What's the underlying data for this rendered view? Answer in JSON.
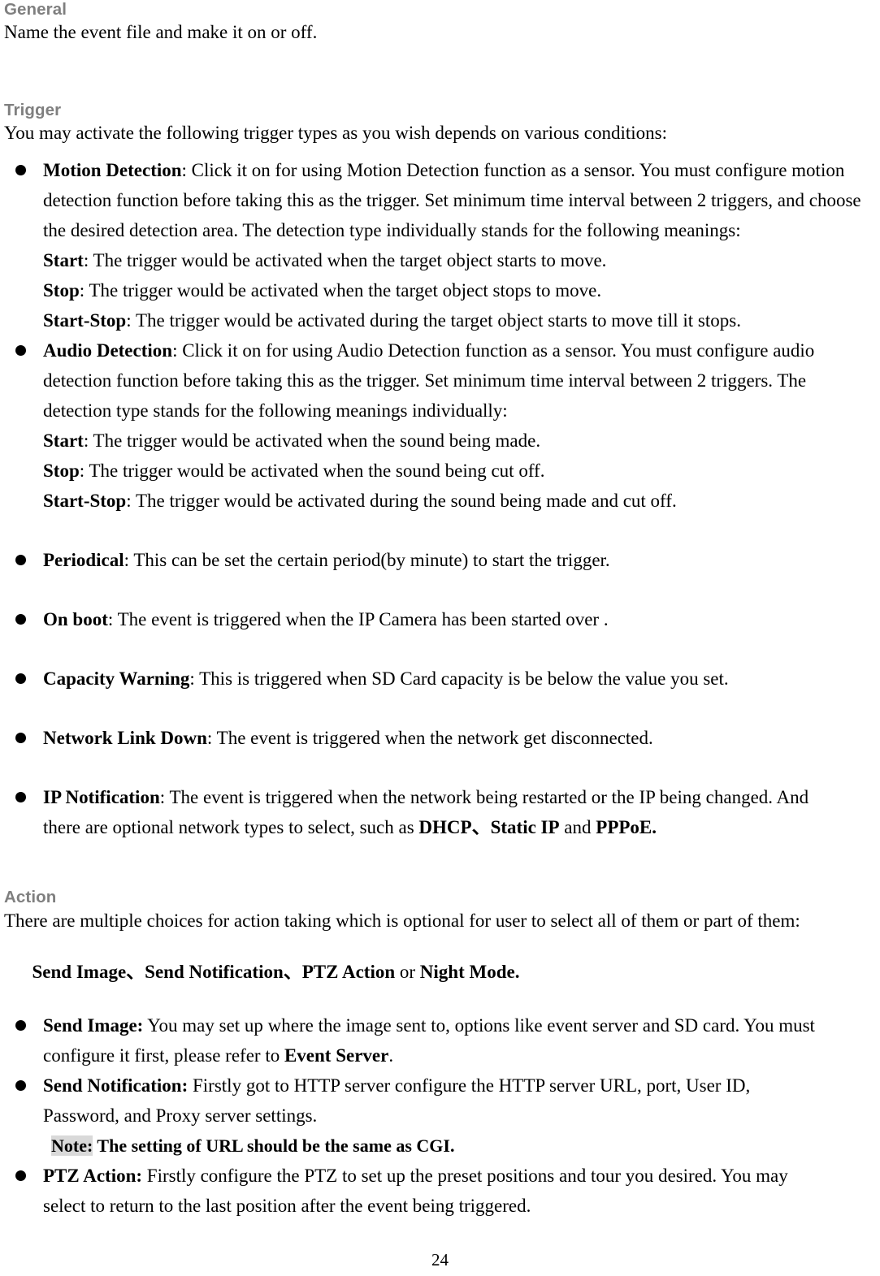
{
  "document": {
    "page_number": "24",
    "sections": [
      {
        "heading": "General",
        "intro": "Name the event file and make it on or off."
      },
      {
        "heading": "Trigger",
        "intro": "You may activate the following trigger types as you wish depends on various conditions:"
      },
      {
        "heading": "Action",
        "intro": "There are multiple choices for action taking which is optional for user to select all of them or part of them:",
        "intro2_parts": {
          "a": "Send Image",
          "sep1": "、",
          "b": "Send Notification",
          "sep2": "、",
          "c": "PTZ Action",
          "or": " or ",
          "d": "Night Mode."
        }
      }
    ]
  },
  "trigger_items": {
    "motion": {
      "term": "Motion Detection",
      "body": ": Click it on for using Motion Detection function as a sensor. You must configure motion detection function before taking this as the trigger. Set minimum time interval between 2 triggers, and choose the desired detection area. The detection type individually stands for the following meanings:",
      "start_term": "Start",
      "start_body": ": The trigger would be activated when the target object starts to move.",
      "stop_term": "Stop",
      "stop_body": ": The trigger would be activated when the target object stops to move.",
      "startstop_term": "Start-Stop",
      "startstop_body": ": The trigger would be activated during the target object starts to move till it stops."
    },
    "audio": {
      "term": "Audio Detection",
      "body": ": Click it on for using Audio Detection function as a sensor. You must configure audio detection function before taking this as the trigger. Set minimum time interval between 2 triggers. The detection type stands for the following meanings individually:",
      "start_term": "Start",
      "start_body": ": The trigger would be activated when the sound being made.",
      "stop_term": "Stop",
      "stop_body": ": The trigger would be activated when the sound being cut off.",
      "startstop_term": "Start-Stop",
      "startstop_body": ": The trigger would be activated during the sound being made and cut off."
    },
    "periodical": {
      "term": "Periodical",
      "body": ": This can be set the certain period(by minute) to start the trigger."
    },
    "on_boot": {
      "term": "On boot",
      "body": ": The event is triggered when the IP Camera has been started over ."
    },
    "capacity_warning": {
      "term": "Capacity Warning",
      "body": ": This is triggered when SD Card capacity is be below the value you set."
    },
    "network_link_down": {
      "term": "Network Link Down",
      "body": ": The event is triggered when the network get disconnected."
    },
    "ip_notification": {
      "term": "IP Notification",
      "body": ": The event is triggered when the network being restarted or the IP being changed. And",
      "line2_pre": "there are optional network types to select, such as ",
      "opt1": "DHCP",
      "sep1": "、",
      "opt2": "Static IP",
      "and": " and ",
      "opt3": "PPPoE."
    }
  },
  "action_items": {
    "send_image": {
      "term": "Send Image:",
      "body": " You may set up where the image sent to, options like event server and SD card. You must",
      "line2_pre": "configure it first, please refer to ",
      "link": "Event Server",
      "line2_post": "."
    },
    "send_notification": {
      "term": "Send Notification:",
      "body": " Firstly got to HTTP server configure the HTTP server URL, port, User ID,",
      "line2": "Password, and Proxy server settings.",
      "note_label": "Note:",
      "note_body": " The setting of URL should be the same as CGI."
    },
    "ptz_action": {
      "term": "PTZ Action:",
      "body": " Firstly configure the PTZ to set up the preset positions and tour you desired. You may",
      "line2": "select to return to the last position after the event being triggered."
    }
  },
  "colors": {
    "heading": "#7f7f7f",
    "text": "#000000",
    "highlight": "#d9d9d9",
    "page_background": "#ffffff"
  }
}
